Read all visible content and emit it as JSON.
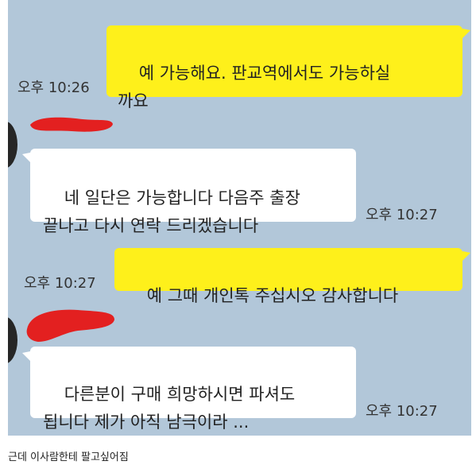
{
  "chat": {
    "messages": [
      {
        "from": "me",
        "text": "예 가능해요. 판교역에서도 가능하실\n까요",
        "time": "오후 10:26"
      },
      {
        "from": "other",
        "text": "네 일단은 가능합니다 다음주 출장\n끝나고 다시 연락 드리겠습니다",
        "time": "오후 10:27"
      },
      {
        "from": "me",
        "text": "예 그때 개인톡 주십시오 감사합니다",
        "time": "오후 10:27"
      },
      {
        "from": "other",
        "text": "다른분이 구매 희망하시면 파셔도\n됩니다 제가 아직 남극이라 ...",
        "time": "오후 10:27"
      }
    ]
  },
  "caption": "근데 이사람한테 팔고싶어짐",
  "colors": {
    "chat_background": "#b2c7d9",
    "my_bubble": "#fef01b",
    "other_bubble": "#ffffff",
    "redaction": "#e32020"
  }
}
